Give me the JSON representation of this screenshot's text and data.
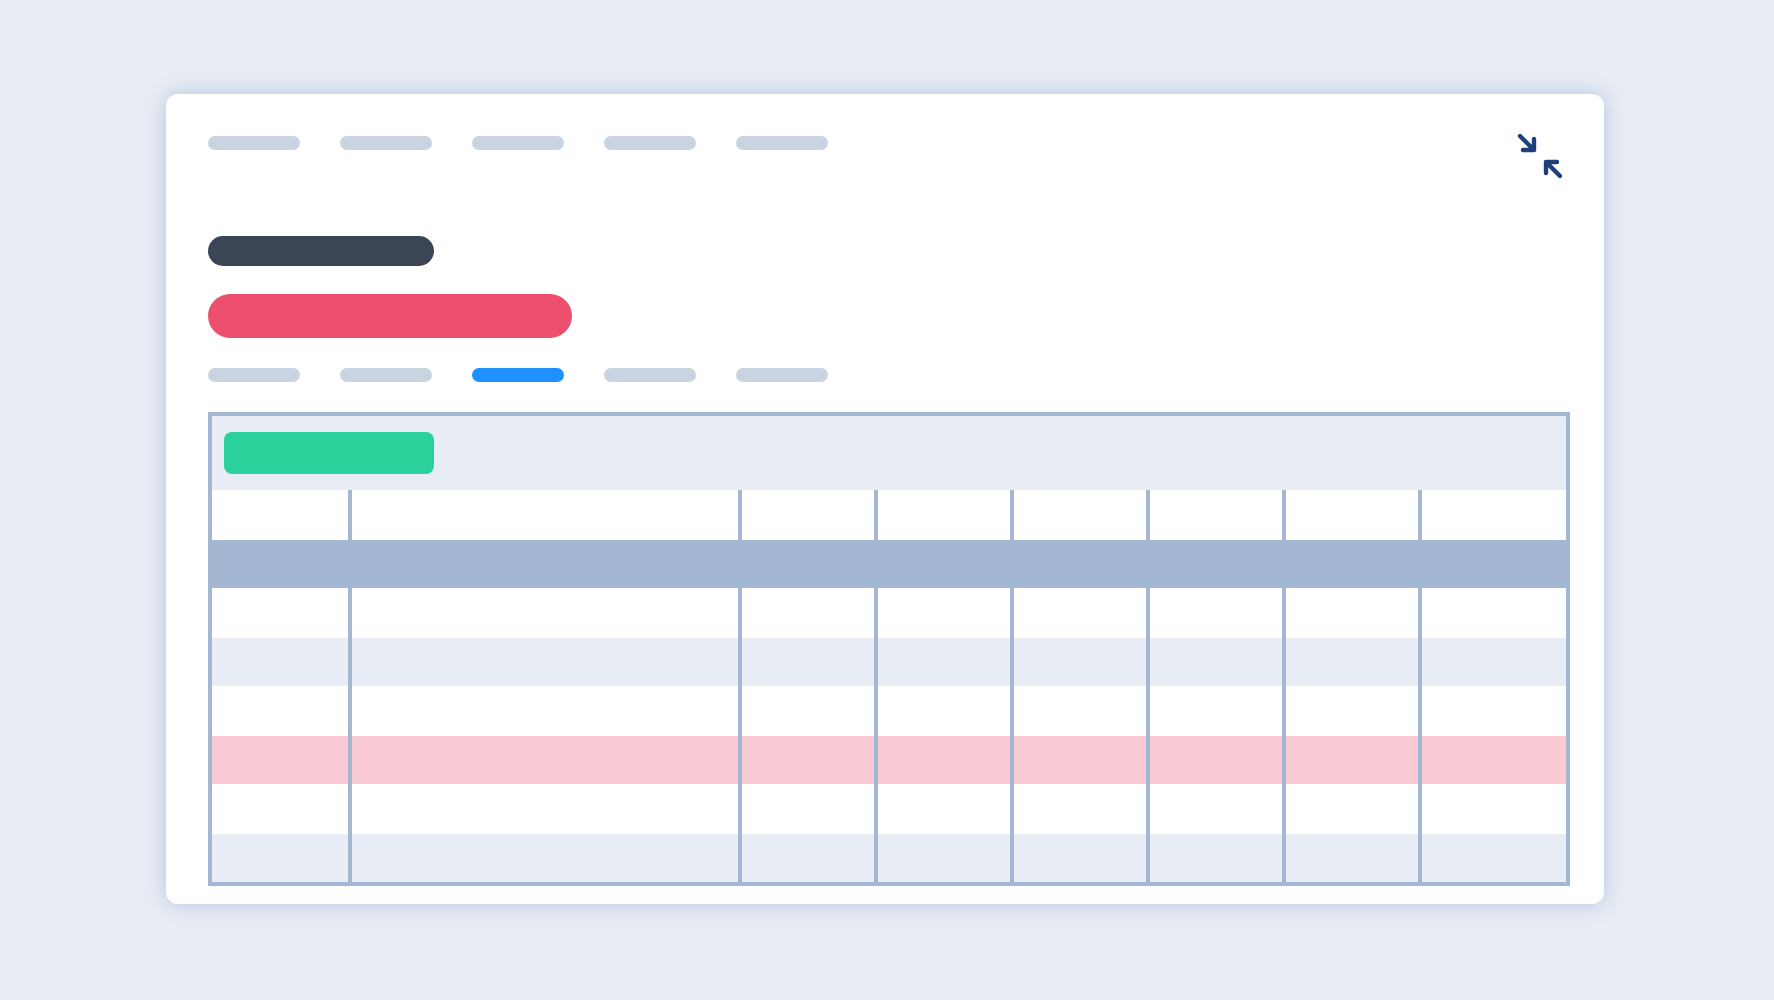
{
  "nav": {
    "items": [
      {
        "selected": false
      },
      {
        "selected": false
      },
      {
        "selected": false
      },
      {
        "selected": false
      },
      {
        "selected": false
      }
    ]
  },
  "tabs": [
    {
      "selected": false
    },
    {
      "selected": false
    },
    {
      "selected": true
    },
    {
      "selected": false
    },
    {
      "selected": false
    }
  ],
  "table": {
    "columns": [
      {
        "kind": "narrow"
      },
      {
        "kind": "wide"
      },
      {
        "kind": "narrow"
      },
      {
        "kind": "narrow"
      },
      {
        "kind": "narrow"
      },
      {
        "kind": "narrow"
      },
      {
        "kind": "narrow"
      },
      {
        "kind": "narrow"
      }
    ],
    "rows": [
      {
        "kind": "header",
        "selected": false
      },
      {
        "kind": "group",
        "selected": false
      },
      {
        "kind": "data",
        "selected": false
      },
      {
        "kind": "data",
        "selected": false
      },
      {
        "kind": "data",
        "selected": false
      },
      {
        "kind": "data",
        "selected": true
      },
      {
        "kind": "data",
        "selected": false
      },
      {
        "kind": "data",
        "selected": false
      }
    ]
  }
}
